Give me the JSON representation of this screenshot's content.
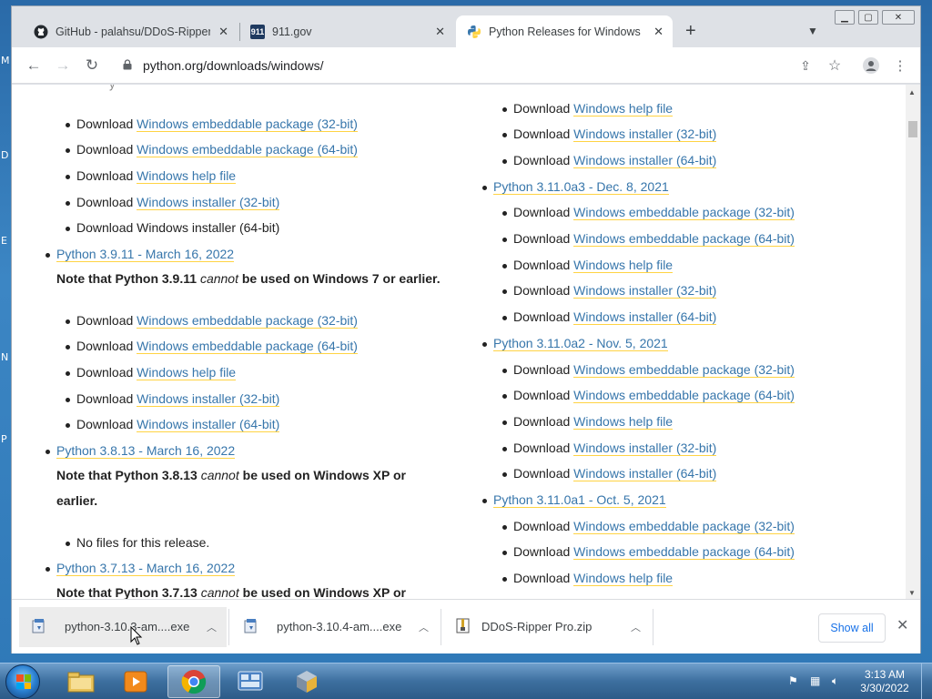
{
  "browser": {
    "tabs": [
      {
        "title": "GitHub - palahsu/DDoS-Ripper: D",
        "icon": "github-icon"
      },
      {
        "title": "911.gov",
        "icon": "911-icon",
        "icon_text": "911"
      },
      {
        "title": "Python Releases for Windows | P",
        "icon": "python-icon"
      }
    ],
    "url": "python.org/downloads/windows/"
  },
  "page": {
    "left": {
      "top_downloads": [
        {
          "prefix": "Download",
          "link": "Windows embeddable package (32-bit)"
        },
        {
          "prefix": "Download",
          "link": "Windows embeddable package (64-bit)"
        },
        {
          "prefix": "Download",
          "link": "Windows help file"
        },
        {
          "prefix": "Download",
          "link": "Windows installer (32-bit)"
        },
        {
          "prefix": "Download",
          "link": "Windows installer (64-bit)"
        }
      ],
      "release_3911": {
        "title": "Python 3.9.11 - March 16, 2022",
        "note_a": "Note that Python 3.9.11 ",
        "note_em": "cannot",
        "note_b": " be used on Windows 7 or earlier.",
        "downloads": [
          {
            "prefix": "Download",
            "link": "Windows embeddable package (32-bit)"
          },
          {
            "prefix": "Download",
            "link": "Windows embeddable package (64-bit)"
          },
          {
            "prefix": "Download",
            "link": "Windows help file"
          },
          {
            "prefix": "Download",
            "link": "Windows installer (32-bit)"
          },
          {
            "prefix": "Download",
            "link": "Windows installer (64-bit)"
          }
        ]
      },
      "release_3813": {
        "title": "Python 3.8.13 - March 16, 2022",
        "note_a": "Note that Python 3.8.13 ",
        "note_em": "cannot",
        "note_b": " be used on Windows XP or",
        "note_c": "earlier.",
        "no_files": "No files for this release."
      },
      "release_3713": {
        "title": "Python 3.7.13 - March 16, 2022",
        "note_a": "Note that Python 3.7.13 ",
        "note_em": "cannot",
        "note_b": " be used on Windows XP or"
      }
    },
    "right": {
      "top_downloads": [
        {
          "prefix": "Download",
          "link": "Windows help file"
        },
        {
          "prefix": "Download",
          "link": "Windows installer (32-bit)"
        },
        {
          "prefix": "Download",
          "link": "Windows installer (64-bit)"
        }
      ],
      "releases": [
        {
          "title": "Python 3.11.0a3 - Dec. 8, 2021",
          "downloads": [
            {
              "prefix": "Download",
              "link": "Windows embeddable package (32-bit)"
            },
            {
              "prefix": "Download",
              "link": "Windows embeddable package (64-bit)"
            },
            {
              "prefix": "Download",
              "link": "Windows help file"
            },
            {
              "prefix": "Download",
              "link": "Windows installer (32-bit)"
            },
            {
              "prefix": "Download",
              "link": "Windows installer (64-bit)"
            }
          ]
        },
        {
          "title": "Python 3.11.0a2 - Nov. 5, 2021",
          "downloads": [
            {
              "prefix": "Download",
              "link": "Windows embeddable package (32-bit)"
            },
            {
              "prefix": "Download",
              "link": "Windows embeddable package (64-bit)"
            },
            {
              "prefix": "Download",
              "link": "Windows help file"
            },
            {
              "prefix": "Download",
              "link": "Windows installer (32-bit)"
            },
            {
              "prefix": "Download",
              "link": "Windows installer (64-bit)"
            }
          ]
        },
        {
          "title": "Python 3.11.0a1 - Oct. 5, 2021",
          "downloads": [
            {
              "prefix": "Download",
              "link": "Windows embeddable package (32-bit)"
            },
            {
              "prefix": "Download",
              "link": "Windows embeddable package (64-bit)"
            },
            {
              "prefix": "Download",
              "link": "Windows help file"
            }
          ]
        }
      ]
    }
  },
  "downloads_bar": {
    "items": [
      {
        "name": "python-3.10.3-am....exe",
        "icon": "installer-file-icon"
      },
      {
        "name": "python-3.10.4-am....exe",
        "icon": "installer-file-icon"
      },
      {
        "name": "DDoS-Ripper Pro.zip",
        "icon": "zip-file-icon"
      }
    ],
    "show_all": "Show all"
  },
  "taskbar": {
    "time": "3:13 AM",
    "date": "3/30/2022"
  },
  "colors": {
    "link": "#3776ab",
    "link_underline": "#ffd343",
    "show_all": "#1a73e8"
  }
}
